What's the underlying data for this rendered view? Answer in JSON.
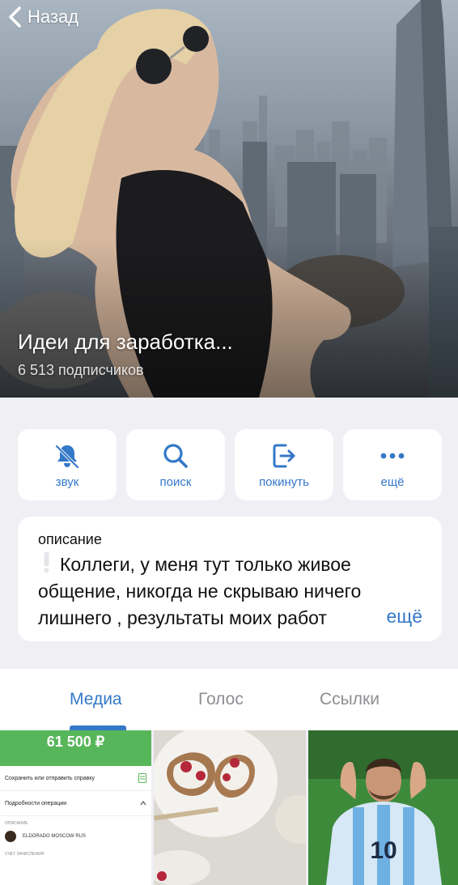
{
  "header": {
    "back_label": "Назад"
  },
  "channel": {
    "title": "Идеи для заработка...",
    "subscribers": "6 513 подписчиков"
  },
  "actions": [
    {
      "label": "звук",
      "icon": "bell-slash-icon"
    },
    {
      "label": "поиск",
      "icon": "search-icon"
    },
    {
      "label": "покинуть",
      "icon": "leave-icon"
    },
    {
      "label": "ещё",
      "icon": "more-dots-icon"
    }
  ],
  "description": {
    "heading": "описание",
    "text": "Коллеги, у меня тут только живое общение, никогда не скрываю ничего лишнего , результаты моих работ",
    "more_label": "ещё"
  },
  "tabs": [
    {
      "label": "Медиа",
      "active": true
    },
    {
      "label": "Голос",
      "active": false
    },
    {
      "label": "Ссылки",
      "active": false
    }
  ],
  "media": {
    "receipt": {
      "amount": "61 500 ₽",
      "row_save": "Сохранить или отправить справку",
      "row_details": "Подробности операции",
      "label_description": "ОПИСАНИЕ",
      "merchant": "ELDORADO MOSCOW RUS",
      "label_account": "СЧЕТ ЗАЧИСЛЕНИЯ"
    },
    "jersey_number": "10"
  },
  "colors": {
    "accent": "#3478c8",
    "background": "#efeff4",
    "card": "#ffffff",
    "receipt_green": "#58b65a"
  }
}
